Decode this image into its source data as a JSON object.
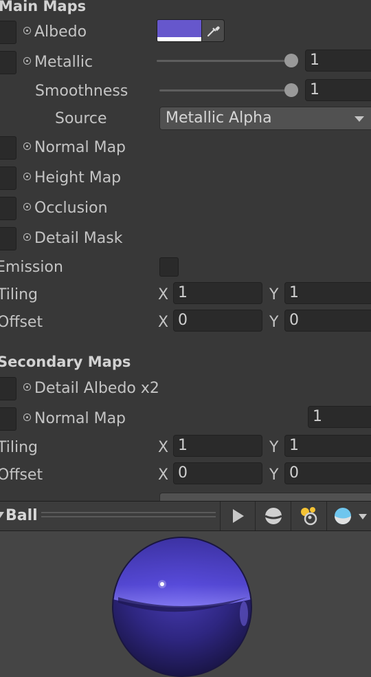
{
  "main_maps": {
    "title": "Main Maps",
    "albedo": {
      "label": "Albedo",
      "color": "#6657cc"
    },
    "metallic": {
      "label": "Metallic",
      "value": "1",
      "slider_fraction": 1.0
    },
    "smoothness": {
      "label": "Smoothness",
      "value": "1",
      "slider_fraction": 1.0
    },
    "source": {
      "label": "Source",
      "value": "Metallic Alpha"
    },
    "normal_map": {
      "label": "Normal Map"
    },
    "height_map": {
      "label": "Height Map"
    },
    "occlusion": {
      "label": "Occlusion"
    },
    "detail_mask": {
      "label": "Detail Mask"
    },
    "emission": {
      "label": "Emission",
      "checked": false
    },
    "tiling": {
      "label": "Tiling",
      "x_label": "X",
      "x": "1",
      "y_label": "Y",
      "y": "1"
    },
    "offset": {
      "label": "Offset",
      "x_label": "X",
      "x": "0",
      "y_label": "Y",
      "y": "0"
    }
  },
  "secondary_maps": {
    "title": "Secondary Maps",
    "detail_albedo": {
      "label": "Detail Albedo x2"
    },
    "normal_map": {
      "label": "Normal Map",
      "value": "1"
    },
    "tiling": {
      "label": "Tiling",
      "x_label": "X",
      "x": "1",
      "y_label": "Y",
      "y": "1"
    },
    "offset": {
      "label": "Offset",
      "x_label": "X",
      "x": "0",
      "y_label": "Y",
      "y": "0"
    }
  },
  "preview": {
    "title": "Ball",
    "buttons": [
      "play-icon",
      "sphere-mesh-icon",
      "lights-icon",
      "skybox-sphere-icon"
    ],
    "material_color": "#3a2f9a"
  }
}
